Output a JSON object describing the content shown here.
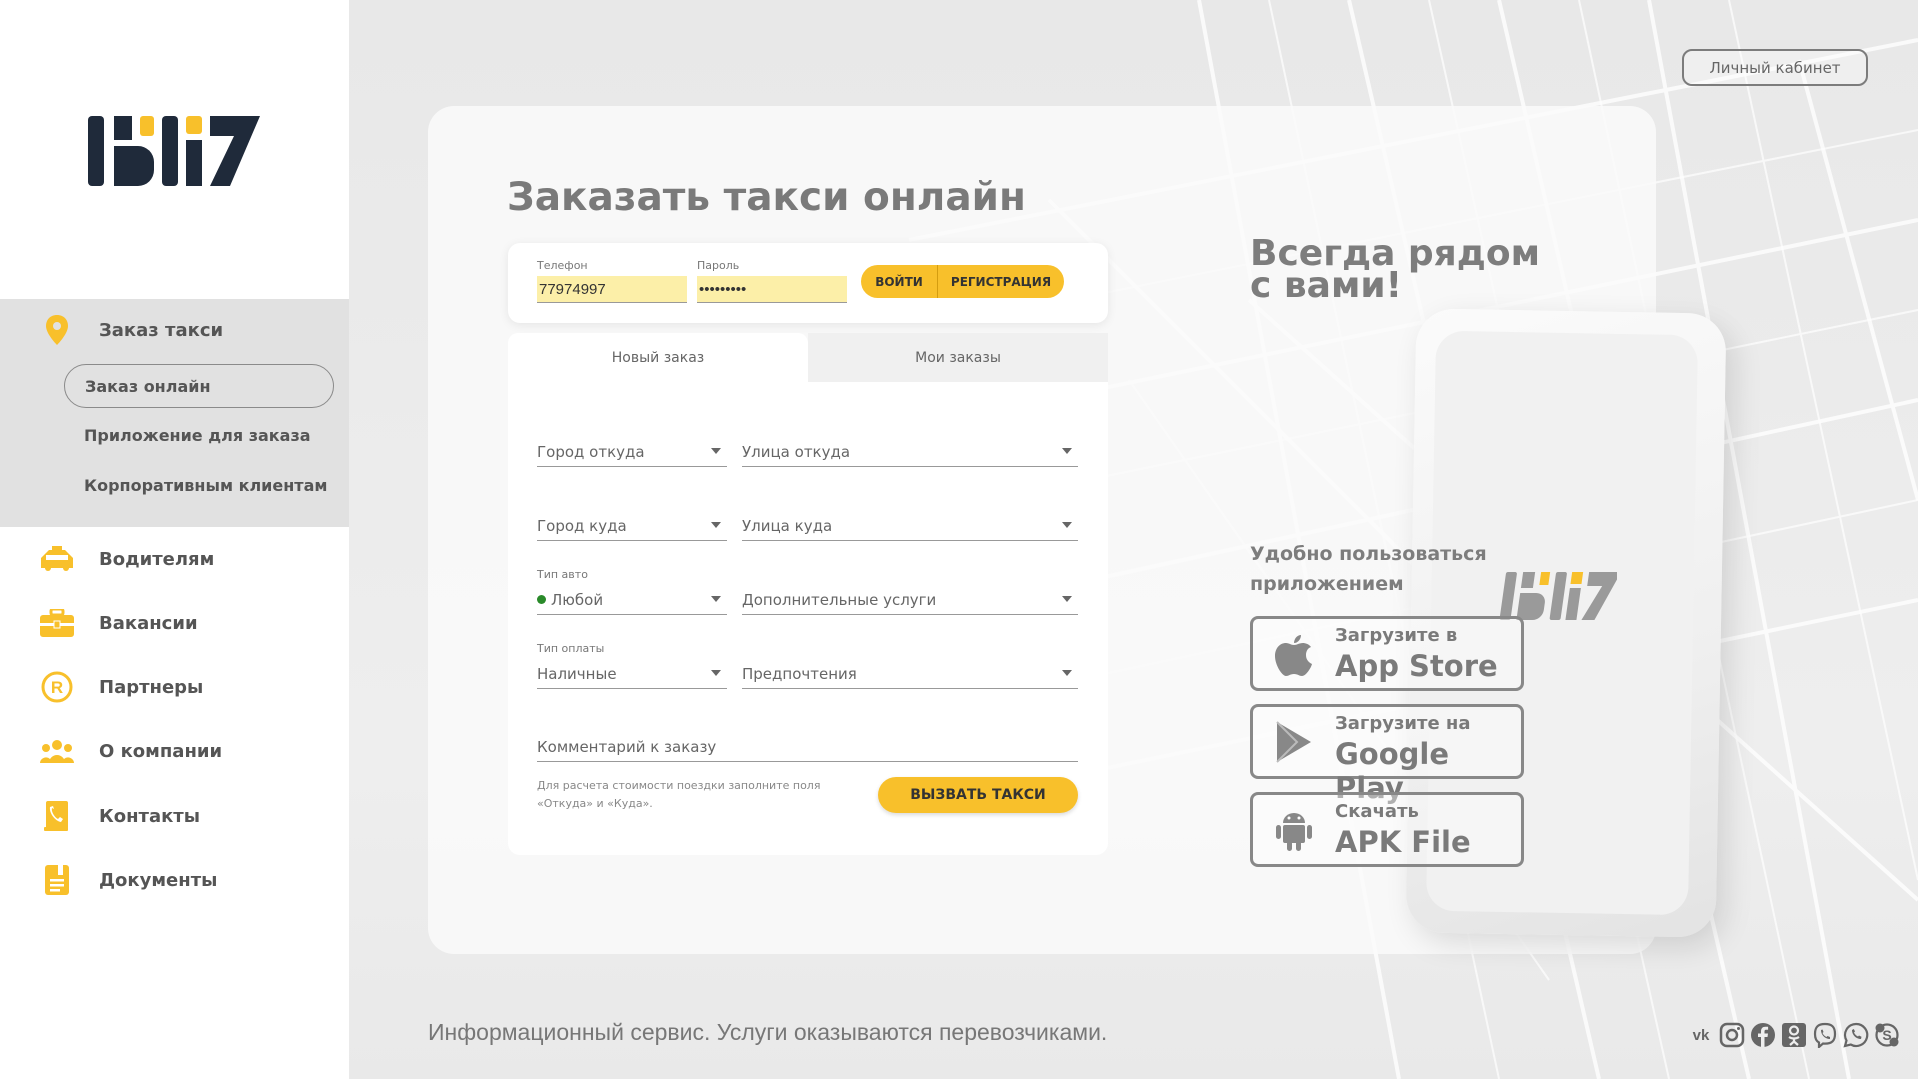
{
  "sidebar": {
    "items": [
      {
        "id": "order",
        "label": "Заказ такси",
        "icon": "location-pin-icon",
        "icon_color": "#f8c02b",
        "subitems": [
          {
            "label": "Заказ онлайн",
            "active": true
          },
          {
            "label": "Приложение для заказа",
            "active": false
          },
          {
            "label": "Корпоративным клиентам",
            "active": false
          }
        ]
      },
      {
        "id": "drivers",
        "label": "Водителям",
        "icon": "taxi-car-icon"
      },
      {
        "id": "vacancies",
        "label": "Вакансии",
        "icon": "briefcase-icon"
      },
      {
        "id": "partners",
        "label": "Партнеры",
        "icon": "registered-icon"
      },
      {
        "id": "about",
        "label": "О компании",
        "icon": "people-icon"
      },
      {
        "id": "contacts",
        "label": "Контакты",
        "icon": "phone-book-icon"
      },
      {
        "id": "documents",
        "label": "Документы",
        "icon": "document-icon"
      }
    ]
  },
  "header": {
    "cabinet_label": "Личный кабинет"
  },
  "main": {
    "title": "Заказать такси онлайн",
    "login": {
      "phone_label": "Телефон",
      "phone_value": "77974997",
      "password_label": "Пароль",
      "password_value": "•••••••••",
      "login_button": "ВОЙТИ",
      "register_button": "РЕГИСТРАЦИЯ"
    },
    "tabs": [
      {
        "label": "Новый заказ",
        "active": true
      },
      {
        "label": "Мои заказы",
        "active": false
      }
    ],
    "form": {
      "city_from": "Город откуда",
      "street_from": "Улица откуда",
      "city_to": "Город куда",
      "street_to": "Улица куда",
      "car_type_label": "Тип авто",
      "car_type_value": "Любой",
      "extra_services": "Дополнительные услуги",
      "payment_label": "Тип оплаты",
      "payment_value": "Наличные",
      "preferences": "Предпочтения",
      "comment_placeholder": "Комментарий к заказу",
      "note": "Для расчета стоимости поездки заполните поля «Откуда» и «Куда».",
      "call_button": "ВЫЗВАТЬ ТАКСИ"
    }
  },
  "promo": {
    "title_line1": "Всегда рядом",
    "title_line2": "с вами!",
    "subtitle_line1": "Удобно пользоваться",
    "subtitle_line2": "приложением",
    "stores": [
      {
        "icon": "apple-icon",
        "line1": "Загрузите в",
        "line2": "App Store"
      },
      {
        "icon": "google-play-icon",
        "line1": "Загрузите на",
        "line2": "Google Play"
      },
      {
        "icon": "android-icon",
        "line1": "Скачать",
        "line2": "APK File"
      }
    ]
  },
  "footer": {
    "text": "Информационный сервис. Услуги оказываются перевозчиками.",
    "socials": [
      "vk-icon",
      "instagram-icon",
      "facebook-icon",
      "odnoklassniki-icon",
      "viber-icon",
      "whatsapp-icon",
      "skype-icon"
    ]
  },
  "colors": {
    "accent": "#f8c02b",
    "dark": "#1f2a3a",
    "gray_text": "#7a7a7a"
  }
}
